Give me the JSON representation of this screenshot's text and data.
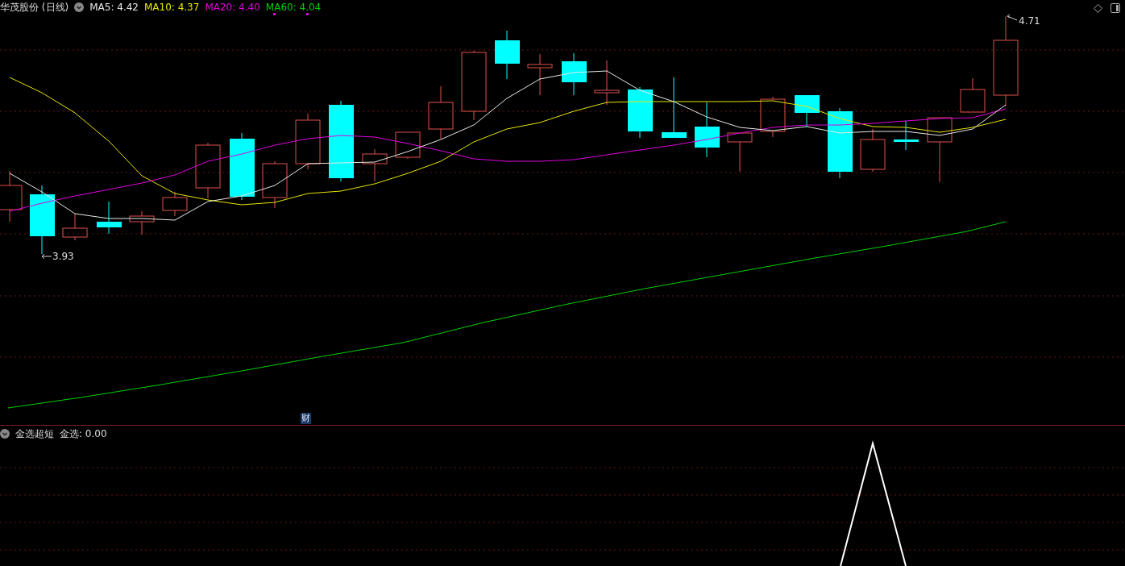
{
  "stock": {
    "name": "华茂股份",
    "period": "(日线)"
  },
  "indicators": [
    {
      "label": "MA5: 4.42",
      "color": "#e8e8e8"
    },
    {
      "label": "MA10: 4.37",
      "color": "#e6e600"
    },
    {
      "label": "MA20: 4.40",
      "color": "#e000e0"
    },
    {
      "label": "MA60: 4.04",
      "color": "#00d000"
    }
  ],
  "price_labels": {
    "high": "4.71",
    "low": "3.93"
  },
  "event_badge": "财",
  "sub_panel": {
    "name": "金选超短",
    "reading": "金选: 0.00"
  }
}
